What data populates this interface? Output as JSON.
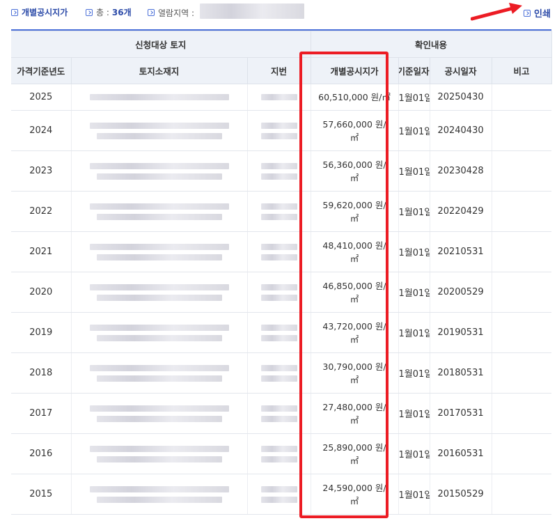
{
  "topbar": {
    "tab_label": "개별공시지가",
    "count_label": "총 :",
    "count_value": "36개",
    "region_label": "열람지역 :",
    "print_label": "인쇄"
  },
  "table": {
    "group_headers": [
      "신청대상 토지",
      "확인내용"
    ],
    "columns": [
      "가격기준년도",
      "토지소재지",
      "지번",
      "개별공시지가",
      "기준일자",
      "공시일자",
      "비고"
    ],
    "rows": [
      {
        "year": "2025",
        "price_line1": "60,510,000 원/㎡",
        "price_line2": "",
        "base_date": "1월01일",
        "pub_date": "20250430",
        "note": ""
      },
      {
        "year": "2024",
        "price_line1": "57,660,000 원/",
        "price_line2": "㎡",
        "base_date": "1월01일",
        "pub_date": "20240430",
        "note": ""
      },
      {
        "year": "2023",
        "price_line1": "56,360,000 원/",
        "price_line2": "㎡",
        "base_date": "1월01일",
        "pub_date": "20230428",
        "note": ""
      },
      {
        "year": "2022",
        "price_line1": "59,620,000 원/",
        "price_line2": "㎡",
        "base_date": "1월01일",
        "pub_date": "20220429",
        "note": ""
      },
      {
        "year": "2021",
        "price_line1": "48,410,000 원/",
        "price_line2": "㎡",
        "base_date": "1월01일",
        "pub_date": "20210531",
        "note": ""
      },
      {
        "year": "2020",
        "price_line1": "46,850,000 원/",
        "price_line2": "㎡",
        "base_date": "1월01일",
        "pub_date": "20200529",
        "note": ""
      },
      {
        "year": "2019",
        "price_line1": "43,720,000 원/",
        "price_line2": "㎡",
        "base_date": "1월01일",
        "pub_date": "20190531",
        "note": ""
      },
      {
        "year": "2018",
        "price_line1": "30,790,000 원/",
        "price_line2": "㎡",
        "base_date": "1월01일",
        "pub_date": "20180531",
        "note": ""
      },
      {
        "year": "2017",
        "price_line1": "27,480,000 원/",
        "price_line2": "㎡",
        "base_date": "1월01일",
        "pub_date": "20170531",
        "note": ""
      },
      {
        "year": "2016",
        "price_line1": "25,890,000 원/",
        "price_line2": "㎡",
        "base_date": "1월01일",
        "pub_date": "20160531",
        "note": ""
      },
      {
        "year": "2015",
        "price_line1": "24,590,000 원/",
        "price_line2": "㎡",
        "base_date": "1월01일",
        "pub_date": "20150529",
        "note": ""
      }
    ]
  },
  "colors": {
    "accent": "#2b4aa8",
    "highlight": "#ec1c24",
    "header_bg": "#eef2f8"
  }
}
